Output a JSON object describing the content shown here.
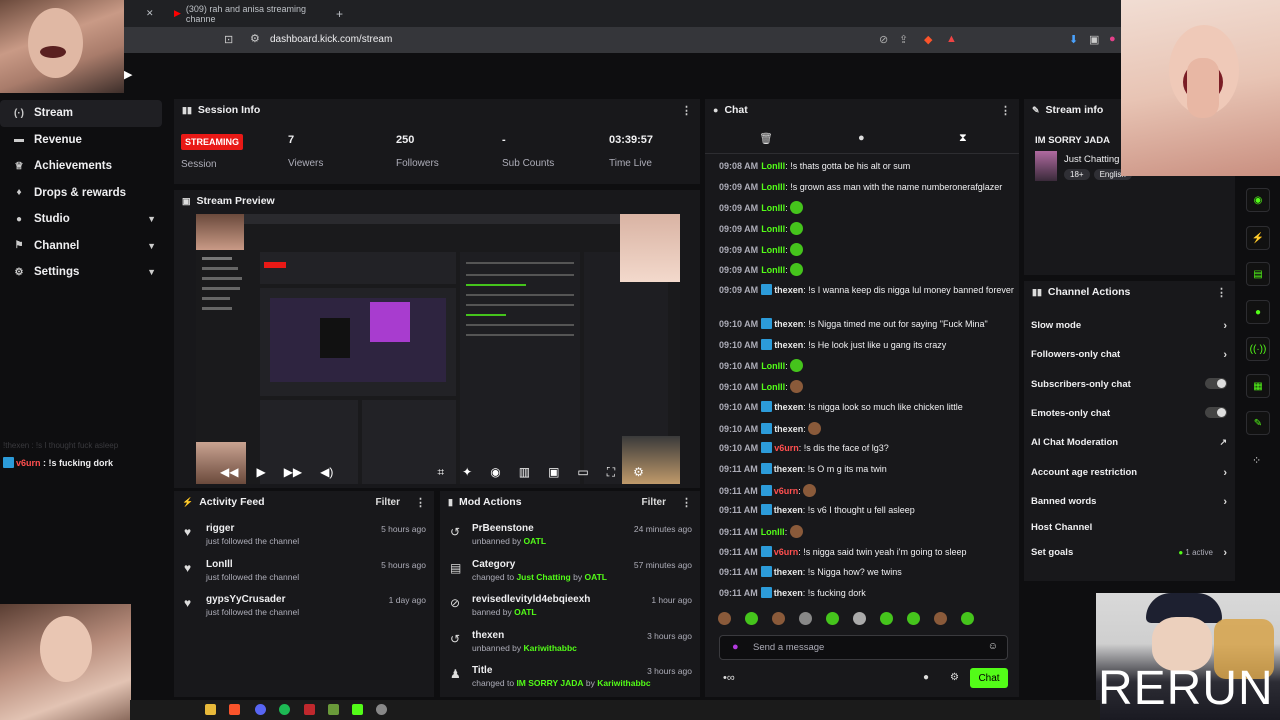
{
  "browser": {
    "tab_title": "(309) rah and anisa streaming channe",
    "url": "dashboard.kick.com/stream"
  },
  "sidebar": {
    "items": [
      {
        "label": "Stream",
        "icon": "stream-icon",
        "active": true
      },
      {
        "label": "Revenue",
        "icon": "revenue-icon"
      },
      {
        "label": "Achievements",
        "icon": "trophy-icon"
      },
      {
        "label": "Drops & rewards",
        "icon": "gift-icon"
      },
      {
        "label": "Studio",
        "icon": "studio-icon",
        "expandable": true
      },
      {
        "label": "Channel",
        "icon": "channel-icon",
        "expandable": true
      },
      {
        "label": "Settings",
        "icon": "gear-icon",
        "expandable": true
      }
    ]
  },
  "overlay_chat": {
    "user": "v6urn",
    "text": " : !s fucking dork",
    "faded": "!thexen : !s I thought fuck asleep"
  },
  "session": {
    "title": "Session Info",
    "status_badge": "STREAMING",
    "status_label": "Session",
    "stats": [
      {
        "value": "7",
        "label": "Viewers"
      },
      {
        "value": "250",
        "label": "Followers"
      },
      {
        "value": "-",
        "label": "Sub Counts"
      },
      {
        "value": "03:39:57",
        "label": "Time Live"
      }
    ]
  },
  "preview": {
    "title": "Stream Preview"
  },
  "activity": {
    "title": "Activity Feed",
    "filter": "Filter",
    "items": [
      {
        "name": "rigger",
        "sub": "just followed the channel",
        "ago": "5 hours ago"
      },
      {
        "name": "LonIll",
        "sub": "just followed the channel",
        "ago": "5 hours ago"
      },
      {
        "name": "gypsYyCrusader",
        "sub": "just followed the channel",
        "ago": "1 day ago"
      }
    ]
  },
  "mod": {
    "title": "Mod Actions",
    "filter": "Filter",
    "items": [
      {
        "title": "PrBeenstone",
        "pre": "unbanned by ",
        "by": "OATL",
        "ago": "24 minutes ago",
        "icon": "undo-icon"
      },
      {
        "title": "Category",
        "pre": "changed to ",
        "mid": "Just Chatting",
        "post": " by ",
        "by": "OATL",
        "ago": "57 minutes ago",
        "icon": "category-icon"
      },
      {
        "title": "revisedlevityld4ebqieexh",
        "pre": "banned by ",
        "by": "OATL",
        "ago": "1 hour ago",
        "icon": "ban-icon"
      },
      {
        "title": "thexen",
        "pre": "unbanned by ",
        "by": "Kariwithabbc",
        "ago": "3 hours ago",
        "icon": "undo-icon"
      },
      {
        "title": "Title",
        "pre": "changed to ",
        "mid": "IM SORRY JADA",
        "post": " by ",
        "by": "Kariwithabbc",
        "ago": "3 hours ago",
        "icon": "title-icon"
      }
    ]
  },
  "chat": {
    "title": "Chat",
    "input_placeholder": "Send a message",
    "send_label": "Chat",
    "messages": [
      {
        "time": "09:08 AM",
        "user": "LonIll",
        "cls": "u1",
        "text": ": !s thats gotta be his alt or sum"
      },
      {
        "time": "09:09 AM",
        "user": "LonIll",
        "cls": "u1",
        "text": ": !s grown ass man with the name numberonerafglazer"
      },
      {
        "time": "09:09 AM",
        "user": "LonIll",
        "cls": "u1",
        "text": ":",
        "emote": true
      },
      {
        "time": "09:09 AM",
        "user": "LonIll",
        "cls": "u1",
        "text": ":",
        "emote": true
      },
      {
        "time": "09:09 AM",
        "user": "LonIll",
        "cls": "u1",
        "text": ":",
        "emote": true
      },
      {
        "time": "09:09 AM",
        "user": "LonIll",
        "cls": "u1",
        "text": ":",
        "emote": true
      },
      {
        "time": "09:09 AM",
        "user": "thexen",
        "cls": "u2",
        "badge": true,
        "text": ": !s I wanna keep dis nigga lul money banned forever"
      },
      {
        "time": "09:10 AM",
        "user": "thexen",
        "cls": "u2",
        "badge": true,
        "text": ": !s Nigga timed me out for saying \"Fuck Mina\""
      },
      {
        "time": "09:10 AM",
        "user": "thexen",
        "cls": "u2",
        "badge": true,
        "text": ": !s He look just like u gang its crazy"
      },
      {
        "time": "09:10 AM",
        "user": "LonIll",
        "cls": "u1",
        "text": ":",
        "emote": true
      },
      {
        "time": "09:10 AM",
        "user": "LonIll",
        "cls": "u1",
        "text": ":",
        "emote": true,
        "brown": true
      },
      {
        "time": "09:10 AM",
        "user": "thexen",
        "cls": "u2",
        "badge": true,
        "text": ": !s nigga look so much like chicken little"
      },
      {
        "time": "09:10 AM",
        "user": "thexen",
        "cls": "u2",
        "badge": true,
        "text": ":",
        "emote": true,
        "brown": true
      },
      {
        "time": "09:10 AM",
        "user": "v6urn",
        "cls": "u3",
        "badge": true,
        "text": ": !s dis the face of lg3?"
      },
      {
        "time": "09:11 AM",
        "user": "thexen",
        "cls": "u2",
        "badge": true,
        "text": ": !s O m g its ma twin"
      },
      {
        "time": "09:11 AM",
        "user": "v6urn",
        "cls": "u3",
        "badge": true,
        "text": ":",
        "emote": true,
        "brown": true
      },
      {
        "time": "09:11 AM",
        "user": "thexen",
        "cls": "u2",
        "badge": true,
        "text": ": !s v6 I thought u fell asleep"
      },
      {
        "time": "09:11 AM",
        "user": "LonIll",
        "cls": "u1",
        "text": ":",
        "emote": true,
        "brown": true
      },
      {
        "time": "09:11 AM",
        "user": "v6urn",
        "cls": "u3",
        "badge": true,
        "text": ": !s nigga said twin yeah i'm going to sleep"
      },
      {
        "time": "09:11 AM",
        "user": "thexen",
        "cls": "u2",
        "badge": true,
        "text": ": !s Nigga how? we twins"
      },
      {
        "time": "09:11 AM",
        "user": "thexen",
        "cls": "u2",
        "badge": true,
        "text": ": !s fucking dork"
      }
    ]
  },
  "stream_info": {
    "title": "Stream info",
    "stream_title": "IM SORRY JADA",
    "category": "Just Chatting",
    "tags": [
      "18+",
      "English"
    ]
  },
  "channel_actions": {
    "title": "Channel Actions",
    "items": [
      {
        "label": "Slow mode",
        "ctl": "arrow"
      },
      {
        "label": "Followers-only chat",
        "ctl": "arrow"
      },
      {
        "label": "Subscribers-only chat",
        "ctl": "toggle"
      },
      {
        "label": "Emotes-only chat",
        "ctl": "toggle"
      },
      {
        "label": "AI Chat Moderation",
        "ctl": "ext"
      },
      {
        "label": "Account age restriction",
        "ctl": "arrow"
      },
      {
        "label": "Banned words",
        "ctl": "arrow"
      },
      {
        "label": "Host Channel",
        "ctl": "none"
      },
      {
        "label": "Set goals",
        "ctl": "arrow",
        "extra": "1 active"
      }
    ]
  },
  "rerun_text": "RERUN",
  "colors": {
    "accent": "#53fc18",
    "live": "#e91916",
    "bg": "#0e0e10",
    "panel": "#18181b"
  }
}
